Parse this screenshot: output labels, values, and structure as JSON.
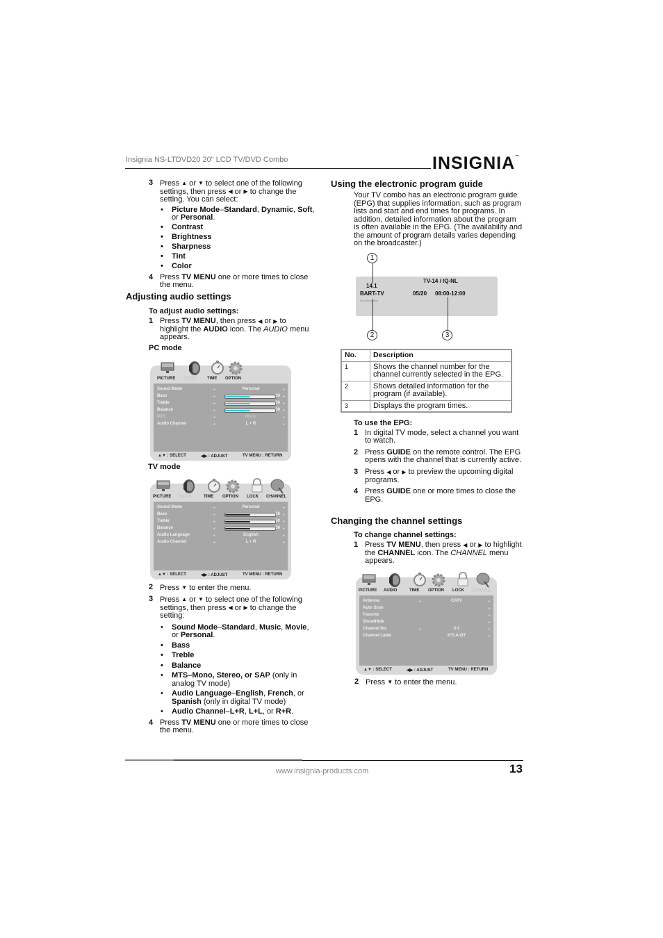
{
  "header": {
    "title": "Insignia NS-LTDVD20 20\" LCD TV/DVD Combo",
    "logo": "INSIGNIA",
    "logo_tm": "™"
  },
  "left": {
    "picture_steps": {
      "step3": {
        "num": "3",
        "pre": "Press",
        "or1": "or",
        "mid": "to select one of the following settings, then press",
        "or2": "or",
        "post": "to change the setting. You can select:"
      },
      "bullets": [
        {
          "bold": "Picture Mode",
          "rest_parts": [
            "–",
            "Standard",
            ", ",
            "Dynamic",
            ",",
            "Soft",
            ", or ",
            "Personal",
            "."
          ]
        },
        {
          "bold": "Contrast"
        },
        {
          "bold": "Brightness"
        },
        {
          "bold": "Sharpness"
        },
        {
          "bold": "Tint"
        },
        {
          "bold": "Color"
        }
      ],
      "step4": {
        "num": "4",
        "pre": "Press",
        "bold": "TV MENU",
        "post": "one or more times to close the menu."
      }
    },
    "audio_section": {
      "heading": "Adjusting audio settings",
      "subheading": "To adjust audio settings:",
      "step1": {
        "num": "1",
        "pre": "Press",
        "bold1": "TV MENU",
        ",then": ", then press",
        "or": "or",
        "to": "to highlight the",
        "bold2": "AUDIO",
        "mid": "icon. The",
        "italic": "AUDIO",
        "post": "menu appears."
      },
      "pc_mode_label": "PC mode",
      "tv_mode_label": "TV mode",
      "step2": {
        "num": "2",
        "pre": "Press",
        "post": "to enter the menu."
      },
      "step3": {
        "num": "3",
        "pre": "Press",
        "or1": "or",
        "mid": "to select one of the following settings, then press",
        "or2": "or",
        "post": "to change the setting:"
      },
      "bullets": {
        "sound_mode": {
          "b1": "Sound Mode",
          "d": "–",
          "b2": "Standard",
          "c1": ", ",
          "b3": "Music",
          "c2": ", ",
          "b4": "Movie",
          "c3": ",",
          "or": "or ",
          "b5": "Personal",
          "end": "."
        },
        "bass": "Bass",
        "treble": "Treble",
        "balance": "Balance",
        "mts": {
          "b": "MTS–Mono, Stereo, or SAP",
          "rest": " (only in analog TV mode)"
        },
        "audio_language": {
          "b1": "Audio Language",
          "d": "–",
          "b2": "English",
          "c1": ", ",
          "b3": "French",
          "c2": ", or",
          "b4": "Spanish",
          "rest": " (only in digital TV mode)"
        },
        "audio_channel": {
          "b1": "Audio Channel",
          "d": "–",
          "b2": "L+R",
          "c1": ", ",
          "b3": "L+L",
          "c2": ", or ",
          "b4": "R+R",
          "end": "."
        }
      },
      "step4": {
        "num": "4",
        "pre": "Press",
        "bold": "TV MENU",
        "post": "one or more times to close the menu."
      }
    }
  },
  "menus": {
    "pc": {
      "tabs": [
        "PICTURE",
        "AUDIO",
        "TIME",
        "OPTION"
      ],
      "active_tab": "AUDIO",
      "rows": [
        {
          "label": "Sound Mode",
          "value": "Personal"
        },
        {
          "label": "Bass",
          "value": "50",
          "slider": 0.5
        },
        {
          "label": "Treble",
          "value": "50",
          "slider": 0.5
        },
        {
          "label": "Balance",
          "value": "50",
          "slider": 0.5
        },
        {
          "label": "MTS",
          "value": "Mono",
          "dim": true
        },
        {
          "label": "Audio Channel",
          "value": "L + R"
        }
      ],
      "footer": {
        "select": "▲▼ : SELECT",
        "adjust": "◀▶ : ADJUST",
        "return": "TV MENU : RETURN"
      },
      "slider_color": "#35c9d9"
    },
    "tv": {
      "tabs": [
        "PICTURE",
        "AUDIO",
        "TIME",
        "OPTION",
        "LOCK",
        "CHANNEL"
      ],
      "active_tab": "AUDIO",
      "rows": [
        {
          "label": "Sound Mode",
          "value": "Personal"
        },
        {
          "label": "Bass",
          "value": "50",
          "slider": 0.5
        },
        {
          "label": "Treble",
          "value": "50",
          "slider": 0.5
        },
        {
          "label": "Balance",
          "value": "50",
          "slider": 0.5
        },
        {
          "label": "Audio Language",
          "value": "English"
        },
        {
          "label": "Audio Channel",
          "value": "L + R"
        }
      ],
      "footer": {
        "select": "▲▼ : SELECT",
        "adjust": "◀▶ : ADJUST",
        "return": "TV MENU : RETURN"
      },
      "slider_color": "#222222"
    },
    "channel": {
      "tabs": [
        "PICTURE",
        "AUDIO",
        "TIME",
        "OPTION",
        "LOCK",
        "CHANNEL"
      ],
      "active_tab": "CHANNEL",
      "rows": [
        {
          "label": "Antenna",
          "value": "CATV",
          "sep": true
        },
        {
          "label": "Auto Scan",
          "value": ""
        },
        {
          "label": "Favorite",
          "value": ""
        },
        {
          "label": "Show/Hide",
          "value": ""
        },
        {
          "label": "Channel No.",
          "value": "5-1",
          "sep": true
        },
        {
          "label": "Channel Label",
          "value": "KTLA-DT"
        }
      ],
      "footer": {
        "select": "▲▼ : SELECT",
        "adjust": "◀▶ : ADJUST",
        "return": "TV MENU : RETURN"
      }
    }
  },
  "right": {
    "epg_section": {
      "heading": "Using the electronic program guide",
      "intro": "Your TV combo has an electronic program guide (EPG) that supplies information, such as program lists and start and end times for programs. In addition, detailed information about the program is often available in the EPG. (The availability and the amount of program details varies depending on the broadcaster.)",
      "epg_screen": {
        "channel_num": "14.1",
        "channel_name": "BART-TV",
        "no_info": "No Information",
        "rating": "TV-14 / IQ-NL",
        "date": "05/20",
        "time": "08:00-12:00"
      },
      "callouts": [
        "1",
        "2",
        "3"
      ],
      "table": {
        "headers": [
          "No.",
          "Description"
        ],
        "rows": [
          [
            "1",
            "Shows the channel number for the channel currently selected in the EPG."
          ],
          [
            "2",
            "Shows detailed information for the program (if available)."
          ],
          [
            "3",
            "Displays the program times."
          ]
        ]
      },
      "use_heading": "To use the EPG:",
      "steps": [
        {
          "num": "1",
          "text": "In digital TV mode, select a channel you want to watch."
        },
        {
          "num": "2",
          "pre": "Press",
          "bold": "GUIDE",
          "post": "on the remote control. The EPG opens with the channel that is currently active."
        },
        {
          "num": "3",
          "pre": "Press",
          "or": "or",
          "post": "to preview the upcoming digital programs."
        },
        {
          "num": "4",
          "pre": "Press",
          "bold": "GUIDE",
          "post": "one or more times to close the EPG."
        }
      ]
    },
    "channel_section": {
      "heading": "Changing the channel settings",
      "subheading": "To change channel settings:",
      "step1": {
        "num": "1",
        "pre": "Press",
        "bold1": "TV MENU",
        ",then": ", then press",
        "or": "or",
        "to": "to highlight the",
        "bold2": "CHANNEL",
        "mid": "icon. The",
        "italic": "CHANNEL",
        "post": "menu appears."
      },
      "step2": {
        "num": "2",
        "pre": "Press",
        "post": "to enter the menu."
      }
    }
  },
  "footer": {
    "url": "www.insignia-products.com",
    "page_number": "13"
  },
  "icons": {
    "up": "▲",
    "down": "▼",
    "left": "◀",
    "right": "▶"
  }
}
